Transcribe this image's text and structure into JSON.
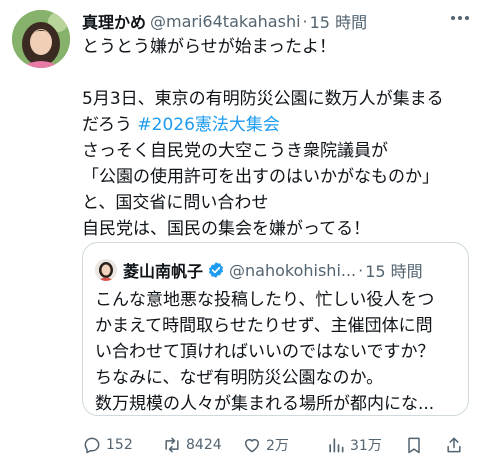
{
  "tweet": {
    "author_name": "真理かめ",
    "author_handle": "@mari64takahashi",
    "separator": "·",
    "time": "15 時間",
    "lines": [
      "とうとう嫌がらせが始まったよ！",
      "",
      "5月3日、東京の有明防災公園に数万人が集まる",
      "だろう #2026憲法大集会",
      "さっそく自民党の大空こうき衆院議員が",
      "「公園の使用許可を出すのはいかがなものか」",
      "と、国交省に問い合わせ",
      "自民党は、国民の集会を嫌がってる！"
    ],
    "line4_prefix": "だろう ",
    "hashtag": "#2026憲法大集会"
  },
  "quote": {
    "author_name": "菱山南帆子",
    "author_handle": "@nahokohishi...",
    "separator": "·",
    "time": "15 時間",
    "lines": [
      "こんな意地悪な投稿したり、忙しい役人をつ",
      "かまえて時間取らせたりせず、主催団体に問",
      "い合わせて頂ければいいのではないですか？",
      "ちなみに、なぜ有明防災公園なのか。",
      "数万規模の人々が集まれる場所が都内にな..."
    ]
  },
  "actions": {
    "reply_count": "152",
    "retweet_count": "8424",
    "like_count": "2万",
    "views_count": "31万"
  },
  "colors": {
    "text": "#0f1419",
    "secondary": "#536471",
    "link": "#1d9bf0",
    "border": "#cfd9de"
  }
}
